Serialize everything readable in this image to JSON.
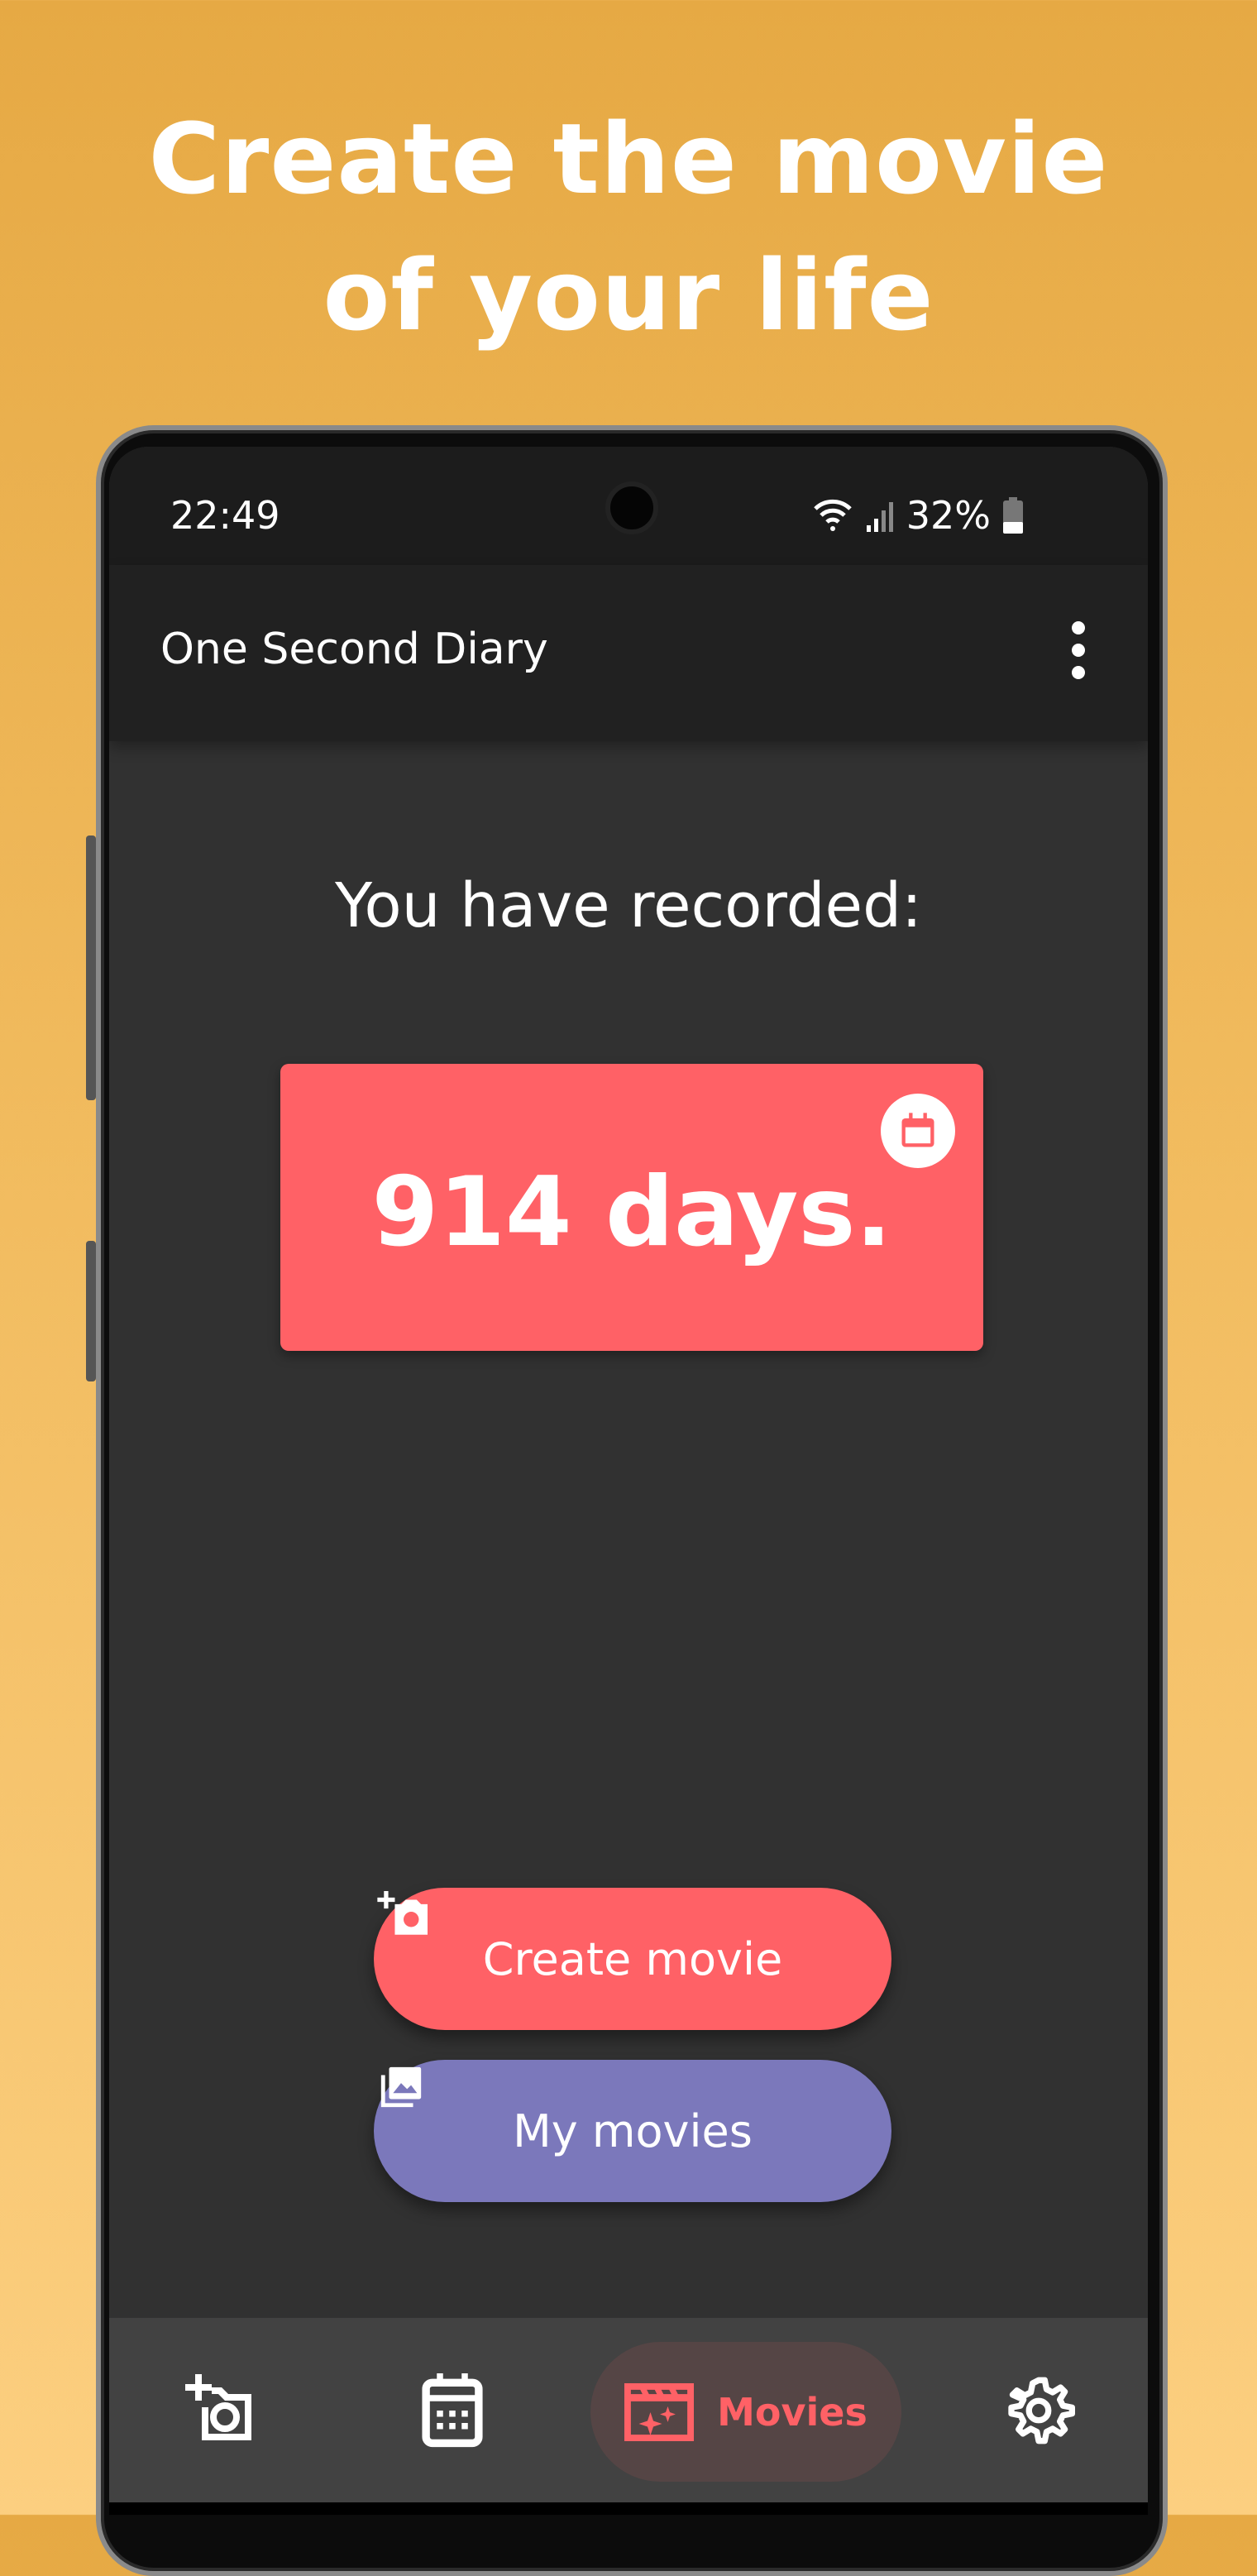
{
  "headline": {
    "line1": "Create the movie",
    "line2": "of your life"
  },
  "status_bar": {
    "time": "22:49",
    "battery": "32%",
    "icons": [
      "wifi-icon",
      "signal-icon",
      "battery-icon"
    ]
  },
  "app_bar": {
    "title": "One Second Diary",
    "menu_icon": "more-vert-icon"
  },
  "main": {
    "recorded_label": "You have recorded:",
    "days_text": "914 days.",
    "calendar_icon": "calendar-icon"
  },
  "buttons": {
    "create_movie": "Create movie",
    "my_movies": "My movies"
  },
  "bottom_nav": {
    "items": [
      {
        "icon": "add-photo-icon"
      },
      {
        "icon": "calendar-icon"
      },
      {
        "icon": "movie-icon",
        "label": "Movies",
        "selected": true
      },
      {
        "icon": "settings-icon"
      }
    ]
  },
  "colors": {
    "accent": "#ff6166",
    "secondary": "#7b78bb",
    "background": "#313131"
  }
}
